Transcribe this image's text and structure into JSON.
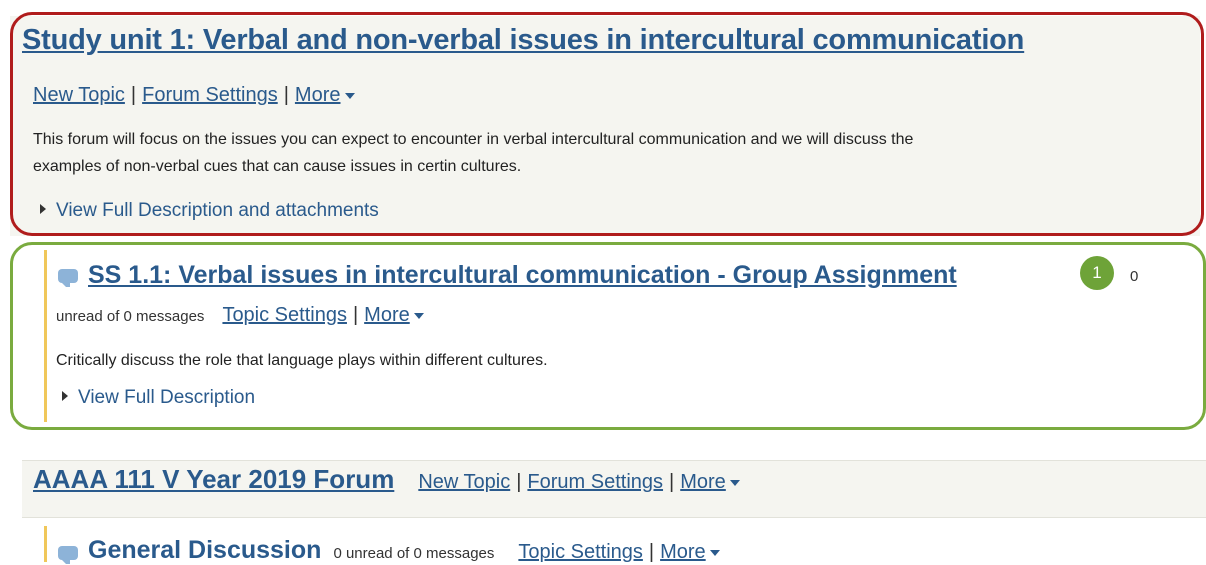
{
  "forum1": {
    "title": "Study unit 1: Verbal and non-verbal issues in intercultural communication",
    "new_topic": "New Topic",
    "forum_settings": "Forum Settings",
    "more": "More",
    "description_line1": "This forum will focus on the issues you can expect to encounter in verbal intercultural communication and we will discuss the",
    "description_line2": "examples of non-verbal cues that can cause issues in certin cultures.",
    "view_full": "View Full Description and attachments"
  },
  "topic1": {
    "title": "SS 1.1: Verbal issues in intercultural communication - Group Assignment",
    "badge": "1",
    "count_tail": "0",
    "unread": "unread of 0 messages",
    "topic_settings": "Topic Settings",
    "more": "More",
    "description": "Critically discuss the role that language plays within different cultures.",
    "view_full": "View Full Description"
  },
  "forum2": {
    "title": "AAAA 111 V Year 2019 Forum",
    "new_topic": "New Topic",
    "forum_settings": "Forum Settings",
    "more": "More"
  },
  "topic2": {
    "title": "General Discussion",
    "unread": "0 unread of 0 messages",
    "topic_settings": "Topic Settings",
    "more": "More"
  },
  "colors": {
    "link": "#2a5a8c",
    "red_highlight": "#b01c1c",
    "green_highlight": "#7aab3f",
    "topic_bar": "#f0c75a"
  }
}
